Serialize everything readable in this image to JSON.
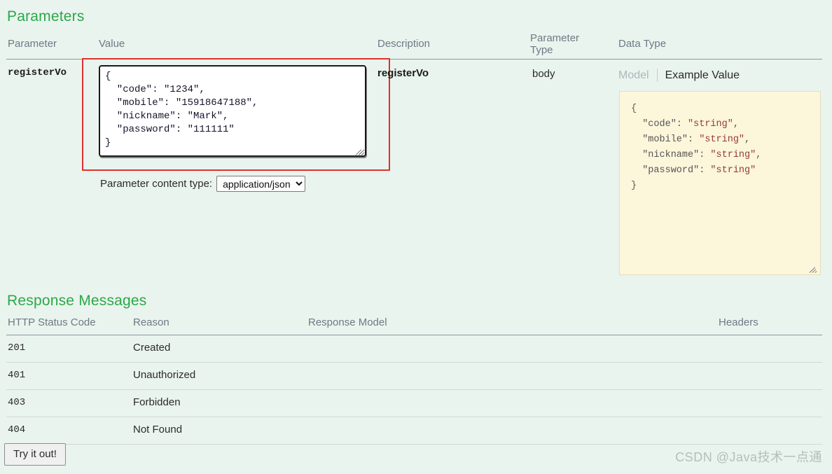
{
  "parameters": {
    "section_title": "Parameters",
    "columns": {
      "parameter": "Parameter",
      "value": "Value",
      "description": "Description",
      "parameter_type": "Parameter Type",
      "data_type": "Data Type"
    },
    "row": {
      "name": "registerVo",
      "description": "registerVo",
      "parameter_type": "body",
      "value_json": "{\n  \"code\": \"1234\",\n  \"mobile\": \"15918647188\",\n  \"nickname\": \"Mark\",\n  \"password\": \"111111\"\n}",
      "content_type_label": "Parameter content type:",
      "content_type_selected": "application/json",
      "content_type_options": [
        "application/json"
      ]
    },
    "data_type": {
      "tab_model": "Model",
      "tab_example_value": "Example Value",
      "active_tab": "Example Value",
      "example_lines": [
        {
          "indent": 0,
          "key": "",
          "text": "{"
        },
        {
          "indent": 1,
          "key": "\"code\":",
          "value": "\"string\"",
          "comma": ","
        },
        {
          "indent": 1,
          "key": "\"mobile\":",
          "value": "\"string\"",
          "comma": ","
        },
        {
          "indent": 1,
          "key": "\"nickname\":",
          "value": "\"string\"",
          "comma": ","
        },
        {
          "indent": 1,
          "key": "\"password\":",
          "value": "\"string\"",
          "comma": ""
        },
        {
          "indent": 0,
          "key": "",
          "text": "}"
        }
      ]
    }
  },
  "responses": {
    "section_title": "Response Messages",
    "columns": {
      "status_code": "HTTP Status Code",
      "reason": "Reason",
      "response_model": "Response Model",
      "headers": "Headers"
    },
    "rows": [
      {
        "code": "201",
        "reason": "Created",
        "model": "",
        "headers": ""
      },
      {
        "code": "401",
        "reason": "Unauthorized",
        "model": "",
        "headers": ""
      },
      {
        "code": "403",
        "reason": "Forbidden",
        "model": "",
        "headers": ""
      },
      {
        "code": "404",
        "reason": "Not Found",
        "model": "",
        "headers": ""
      }
    ]
  },
  "actions": {
    "try_it_out": "Try it out!"
  },
  "watermark": "CSDN @Java技术一点通",
  "colors": {
    "page_background": "#eaf4ee",
    "section_heading": "#2aa84a",
    "highlight_border": "#e03030",
    "example_box_background": "#fcf6db",
    "example_string_value": "#953a3a",
    "column_header_text": "#6b7a85"
  }
}
